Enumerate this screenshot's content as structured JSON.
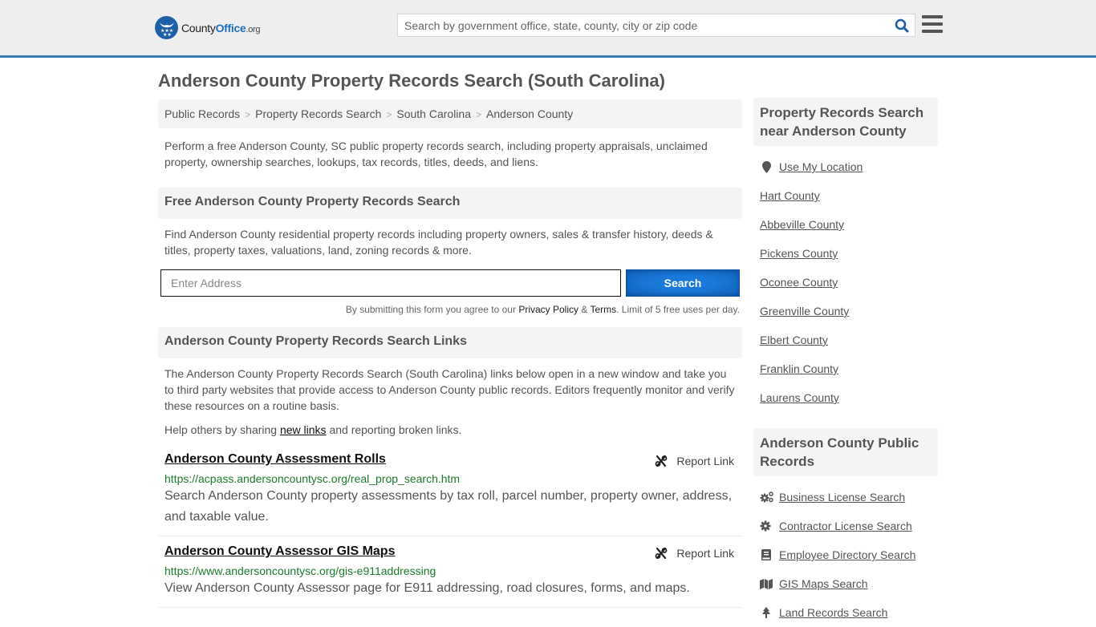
{
  "header": {
    "logo": {
      "county": "County",
      "office": "Office",
      "org": ".org"
    },
    "search_placeholder": "Search by government office, state, county, city or zip code",
    "accent_color": "#3a7cb0"
  },
  "page_title": "Anderson County Property Records Search (South Carolina)",
  "breadcrumb": [
    "Public Records",
    "Property Records Search",
    "South Carolina",
    "Anderson County"
  ],
  "intro": "Perform a free Anderson County, SC public property records search, including property appraisals, unclaimed property, ownership searches, lookups, tax records, titles, deeds, and liens.",
  "free_search": {
    "heading": "Free Anderson County Property Records Search",
    "description": "Find Anderson County residential property records including property owners, sales & transfer history, deeds & titles, property taxes, valuations, land, zoning records & more.",
    "input_placeholder": "Enter Address",
    "button_label": "Search",
    "disclaimer_prefix": "By submitting this form you agree to our ",
    "privacy_label": "Privacy Policy",
    "amp": " & ",
    "terms_label": "Terms",
    "disclaimer_suffix": ". Limit of 5 free uses per day."
  },
  "links_section": {
    "heading": "Anderson County Property Records Search Links",
    "description": "The Anderson County Property Records Search (South Carolina) links below open in a new window and take you to third party websites that provide access to Anderson County public records. Editors frequently monitor and verify these resources on a routine basis.",
    "help_prefix": "Help others by sharing ",
    "help_link": "new links",
    "help_suffix": " and reporting broken links.",
    "report_label": "Report Link",
    "items": [
      {
        "title": "Anderson County Assessment Rolls",
        "url": "https://acpass.andersoncountysc.org/real_prop_search.htm",
        "description": "Search Anderson County property assessments by tax roll, parcel number, property owner, address, and taxable value."
      },
      {
        "title": "Anderson County Assessor GIS Maps",
        "url": "https://www.andersoncountysc.org/gis-e911addressing",
        "description": "View Anderson County Assessor page for E911 addressing, road closures, forms, and maps."
      }
    ]
  },
  "sidebar": {
    "nearby_heading": "Property Records Search near Anderson County",
    "use_location": "Use My Location",
    "nearby": [
      "Hart County",
      "Abbeville County",
      "Pickens County",
      "Oconee County",
      "Greenville County",
      "Elbert County",
      "Franklin County",
      "Laurens County"
    ],
    "public_heading": "Anderson County Public Records",
    "public_records": [
      {
        "label": "Business License Search",
        "icon": "cogs-icon"
      },
      {
        "label": "Contractor License Search",
        "icon": "gear-icon"
      },
      {
        "label": "Employee Directory Search",
        "icon": "book-icon"
      },
      {
        "label": "GIS Maps Search",
        "icon": "map-icon"
      },
      {
        "label": "Land Records Search",
        "icon": "tree-icon"
      }
    ]
  }
}
